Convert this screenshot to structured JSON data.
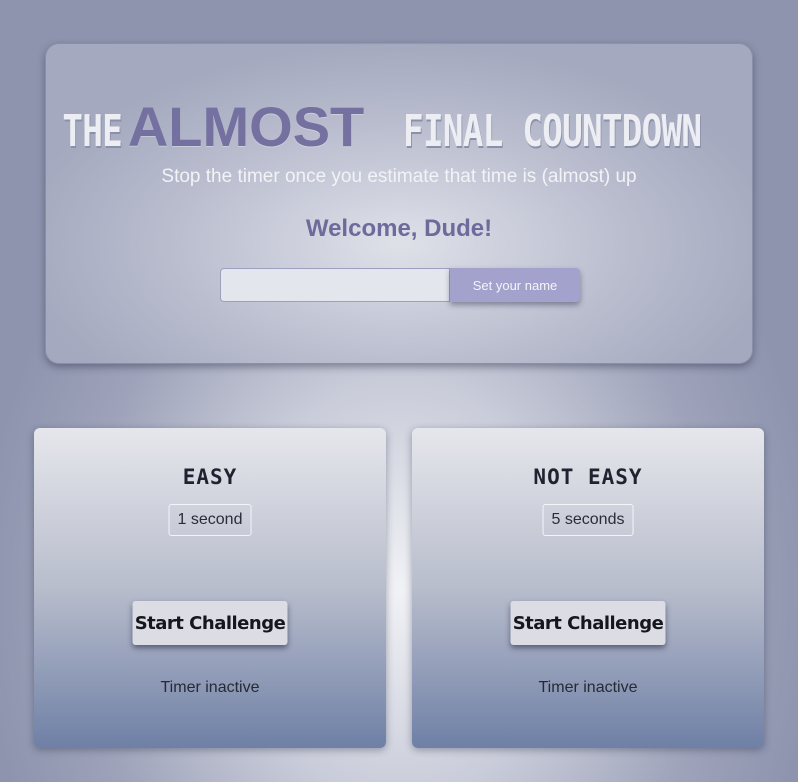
{
  "header": {
    "title_prefix": "THE",
    "title_emphasis": "ALMOST",
    "title_suffix": "FINAL COUNTDOWN",
    "subtitle": "Stop the timer once you estimate that time is (almost) up",
    "welcome": "Welcome, Dude!",
    "name_input": {
      "value": "",
      "placeholder": ""
    },
    "set_name_label": "Set your name"
  },
  "challenges": [
    {
      "title": "EASY",
      "duration": "1 second",
      "button_label": "Start Challenge",
      "status": "Timer inactive"
    },
    {
      "title": "NOT EASY",
      "duration": "5 seconds",
      "button_label": "Start Challenge",
      "status": "Timer inactive"
    }
  ],
  "colors": {
    "accent": "#7470a0",
    "button_accent": "#a3a2cc"
  }
}
